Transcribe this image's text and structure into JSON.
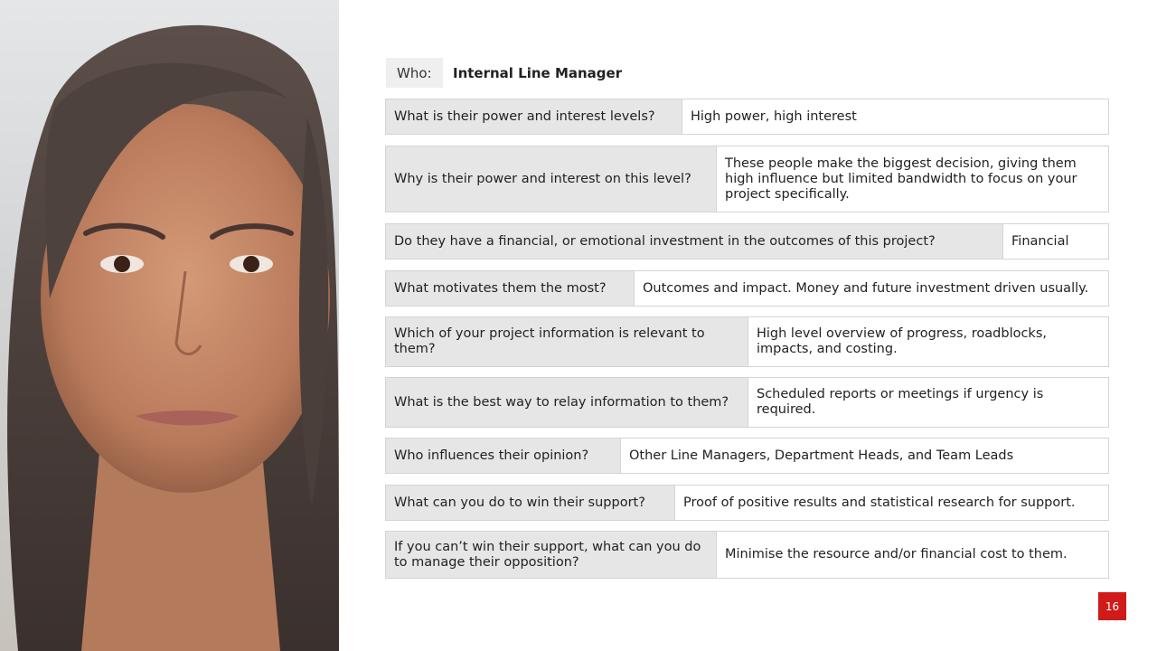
{
  "who": {
    "label": "Who:",
    "value": "Internal Line Manager"
  },
  "rows": [
    {
      "question": "What is their power and interest levels?",
      "answer": "High power, high interest"
    },
    {
      "question": "Why is their power and interest on this level?",
      "answer": "These people make the biggest decision, giving them high influence but limited bandwidth to focus on your project specifically."
    },
    {
      "question": "Do they have a financial, or emotional investment in the outcomes of this project?",
      "answer": "Financial"
    },
    {
      "question": "What motivates them the most?",
      "answer": "Outcomes and impact. Money and future investment driven usually."
    },
    {
      "question": "Which of your project information is relevant to them?",
      "answer": "High level overview of progress, roadblocks, impacts, and costing."
    },
    {
      "question": "What is the best way to relay information to them?",
      "answer": "Scheduled reports or meetings if urgency is required."
    },
    {
      "question": "Who influences their opinion?",
      "answer": "Other Line Managers, Department Heads, and Team Leads"
    },
    {
      "question": "What can you do to win their support?",
      "answer": "Proof of positive results and statistical research for support."
    },
    {
      "question": "If you can’t win their support, what can you do to manage their opposition?",
      "answer": "Minimise the resource and/or financial cost to them."
    }
  ],
  "page_number": "16",
  "colors": {
    "accent": "#d11a1a",
    "question_bg": "#e6e6e6",
    "border": "#d4d4d4"
  }
}
